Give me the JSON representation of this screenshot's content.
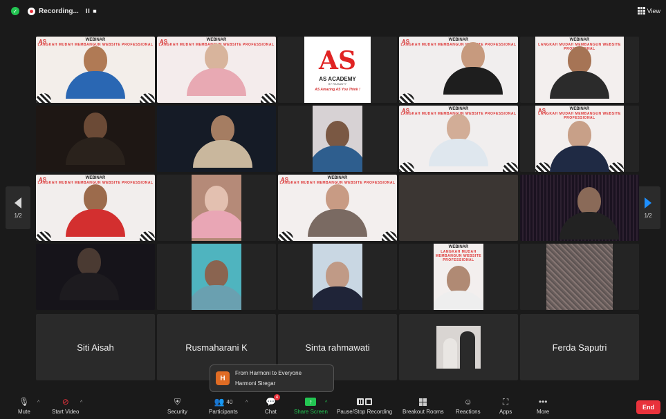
{
  "topbar": {
    "recording_label": "Recording...",
    "recording_controls": "II ■",
    "view_label": "View"
  },
  "pager": {
    "left_label": "1/2",
    "right_label": "1/2"
  },
  "banner": {
    "title": "WEBINAR",
    "subtitle": "LANGKAH MUDAH MEMBANGUN WEBSITE PROFESSIONAL",
    "mark": "AS"
  },
  "logo": {
    "mark": "AS",
    "title": "AS ACADEMY",
    "by": "BY RAISANTY",
    "tagline": "AS Amazing AS You Think !"
  },
  "name_tiles": {
    "t1": "Siti Aisah",
    "t2": "Rusmaharani K",
    "t3": "Sinta rahmawati",
    "t5": "Ferda Saputri"
  },
  "chat_toast": {
    "avatar_letter": "H",
    "header": "From Harmoni to Everyone",
    "message": "Harmoni Siregar"
  },
  "toolbar": {
    "mute": "Mute",
    "start_video": "Start Video",
    "security": "Security",
    "participants": "Participants",
    "participants_count": "40",
    "chat": "Chat",
    "chat_badge": "4",
    "share_screen": "Share Screen",
    "recording": "Pause/Stop Recording",
    "breakout": "Breakout Rooms",
    "reactions": "Reactions",
    "apps": "Apps",
    "more": "More",
    "end": "End"
  },
  "colors": {
    "background": "#1a1a1a",
    "tile": "#242424",
    "active_speaker": "#3cc24a",
    "share_green": "#23c552",
    "end_red": "#e8323c",
    "brand_red": "#d32f2f"
  }
}
